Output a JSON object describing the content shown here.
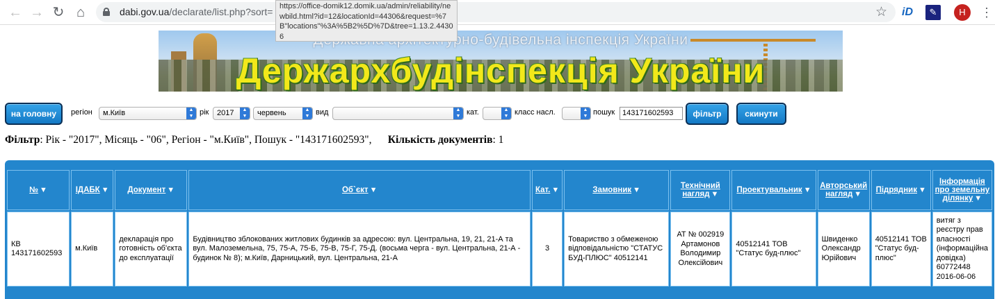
{
  "browser": {
    "url_domain": "dabi.gov.ua",
    "url_path": "/declarate/list.php?sort=",
    "tooltip": "https://office-domik12.domik.ua/admin/reliability/newbild.html?id=12&locationId=44306&request=%7B\"locations\"%3A%5B2%5D%7D&tree=1.13.2.44306",
    "avatar_letter": "H",
    "ext_id_label": "iD"
  },
  "banner": {
    "subtitle": "Державна архітектурно-будівельна інспекція України",
    "title": "Держархбудінспекція України"
  },
  "filters": {
    "home_button": "на головну",
    "region_label": "регіон",
    "region_value": "м.Київ",
    "year_label": "рік",
    "year_value": "2017",
    "month_value": "червень",
    "type_label": "вид",
    "type_value": "",
    "cat_label": "кат.",
    "cat_value": "",
    "class_label": "класс насл.",
    "class_value": "",
    "search_label": "пошук",
    "search_value": "143171602593",
    "filter_button": "фільтр",
    "reset_button": "скинути"
  },
  "summary": {
    "filter_label": "Фільтр",
    "filter_text": ": Рік - \"2017\", Місяць - \"06\", Регіон - \"м.Київ\", Пошук - \"143171602593\",",
    "count_label": "Кількість документів",
    "count_text": ": 1"
  },
  "table": {
    "headers": [
      "№",
      "ІДАБК",
      "Документ",
      "Об`єкт",
      "Кат.",
      "Замовник",
      "Технічний нагляд",
      "Проектувальник",
      "Авторський нагляд",
      "Підрядник",
      "Інформація про земельну ділянку"
    ],
    "sort_glyph": "▼",
    "rows": [
      {
        "no": "КВ 143171602593",
        "idabk": "м.Київ",
        "document": "декларація про готовність об'єкта до експлуатації",
        "object": "Будівництво зблокованих житлових будинків за адресою: вул. Центральна, 19, 21, 21-А та вул. Малоземельна, 75, 75-А, 75-Б, 75-В, 75-Г, 75-Д. (восьма черга - вул. Центральна, 21-А - будинок № 8); м.Київ, Дарницький, вул. Центральна, 21-А",
        "cat": "3",
        "customer": "Товариство з обмеженою відповідальністю \"СТАТУС БУД-ПЛЮС\" 40512141",
        "tech_supervision": "АТ № 002919 Артамонов Володимир Олексійович",
        "designer": "40512141 ТОВ \"Статус буд-плюс\"",
        "author_supervision": "Швиденко Олександр Юрійович",
        "contractor": "40512141 ТОВ \"Статус буд-плюс\"",
        "land_info": "витяг з реєстру прав власності (інформаційна довідка) 60772448 2016-06-06"
      }
    ]
  }
}
